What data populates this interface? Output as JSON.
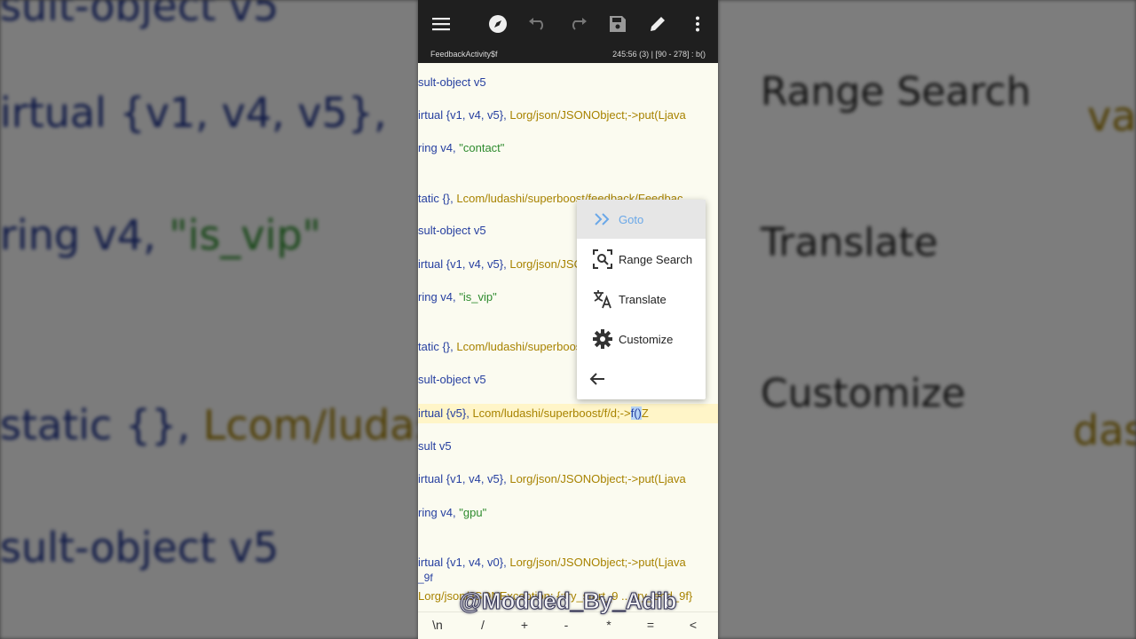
{
  "background": {
    "left_lines": [
      {
        "parts": [
          {
            "t": "sult-object v5",
            "c": "ins"
          }
        ]
      },
      {
        "parts": [
          {
            "t": "irtual {v1, v4, v5}, ",
            "c": "ins"
          }
        ]
      },
      {
        "parts": [
          {
            "t": "ring v4, ",
            "c": "ins"
          },
          {
            "t": "\"is_vip\"",
            "c": "str"
          }
        ]
      },
      {
        "parts": [
          {
            "t": "static {}, ",
            "c": "ins"
          },
          {
            "t": "Lcom/ludas",
            "c": "cls"
          }
        ]
      },
      {
        "parts": [
          {
            "t": "sult-object v5",
            "c": "ins"
          }
        ]
      }
    ],
    "right_items": [
      "Range Search",
      "Translate",
      "Customize"
    ],
    "right_edge": [
      "va",
      "das"
    ]
  },
  "toolbar": {
    "icons": [
      "menu-icon",
      "compass-icon",
      "undo-icon",
      "redo-icon",
      "save-icon",
      "edit-icon",
      "more-vert-icon"
    ]
  },
  "status": {
    "file": "FeedbackActivity$f",
    "position": "245:56 (3)  |  [90 - 278] : b()"
  },
  "code_lines": [
    [
      {
        "t": "sult-object",
        "c": "ins"
      },
      {
        "t": "  v5",
        "c": "reg"
      }
    ],
    [
      {
        "t": "irtual",
        "c": "ins"
      },
      {
        "t": " {v1, v4, v5}, ",
        "c": "reg"
      },
      {
        "t": "Lorg/json/JSONObject;->put(Ljava",
        "c": "cls"
      }
    ],
    [
      {
        "t": "ring",
        "c": "ins"
      },
      {
        "t": "  v4, ",
        "c": "reg"
      },
      {
        "t": "\"contact\"",
        "c": "str"
      }
    ],
    [],
    [
      {
        "t": "tatic",
        "c": "ins"
      },
      {
        "t": " {}, ",
        "c": "reg"
      },
      {
        "t": "Lcom/ludashi/superboost/feedback/Feedbac",
        "c": "cls"
      }
    ],
    [
      {
        "t": "sult-object",
        "c": "ins"
      },
      {
        "t": "  v5",
        "c": "reg"
      }
    ],
    [
      {
        "t": "irtual",
        "c": "ins"
      },
      {
        "t": " {v1, v4, v5}, ",
        "c": "reg"
      },
      {
        "t": "Lorg/json/JSONObject;->put(Ljava",
        "c": "cls"
      }
    ],
    [
      {
        "t": "ring",
        "c": "ins"
      },
      {
        "t": "  v4, ",
        "c": "reg"
      },
      {
        "t": "\"is_vip\"",
        "c": "str"
      }
    ],
    [],
    [
      {
        "t": "tatic",
        "c": "ins"
      },
      {
        "t": " {}, ",
        "c": "reg"
      },
      {
        "t": "Lcom/ludashi/superboost/feedback/Feedbac",
        "c": "cls"
      }
    ],
    [
      {
        "t": "sult-object",
        "c": "ins"
      },
      {
        "t": "  v5",
        "c": "reg"
      }
    ],
    [
      {
        "t": "irtual",
        "c": "ins"
      },
      {
        "t": " {v5}, ",
        "c": "reg"
      },
      {
        "t": "Lcom/ludashi/superboost/f/d;->",
        "c": "cls"
      },
      {
        "t": "f()",
        "c": "sel"
      },
      {
        "t": "Z",
        "c": "cls"
      }
    ],
    [
      {
        "t": "sult",
        "c": "ins"
      },
      {
        "t": "  v5",
        "c": "reg"
      }
    ],
    [
      {
        "t": "irtual",
        "c": "ins"
      },
      {
        "t": " {v1, v4, v5}, ",
        "c": "reg"
      },
      {
        "t": "Lorg/json/JSONObject;->put(Ljava",
        "c": "cls"
      }
    ],
    [
      {
        "t": "ring",
        "c": "ins"
      },
      {
        "t": "  v4, ",
        "c": "reg"
      },
      {
        "t": "\"gpu\"",
        "c": "str"
      }
    ],
    [],
    [
      {
        "t": "irtual",
        "c": "ins"
      },
      {
        "t": " {v1, v4, v0}, ",
        "c": "reg"
      },
      {
        "t": "Lorg/json/JSONObject;->put(Ljava",
        "c": "cls"
      }
    ],
    [
      {
        "t": "_9f",
        "c": "ins"
      }
    ],
    [
      {
        "t": "Lorg/json/JSONException; {:try_start_9 .. :try_end_9f}",
        "c": "cls"
      }
    ]
  ],
  "popup": {
    "goto": "Goto",
    "range_search": "Range Search",
    "translate": "Translate",
    "customize": "Customize"
  },
  "keys": [
    "\\n",
    "/",
    "+",
    "-",
    "*",
    "=",
    "<"
  ],
  "watermark": "@Modded_By_Adib"
}
